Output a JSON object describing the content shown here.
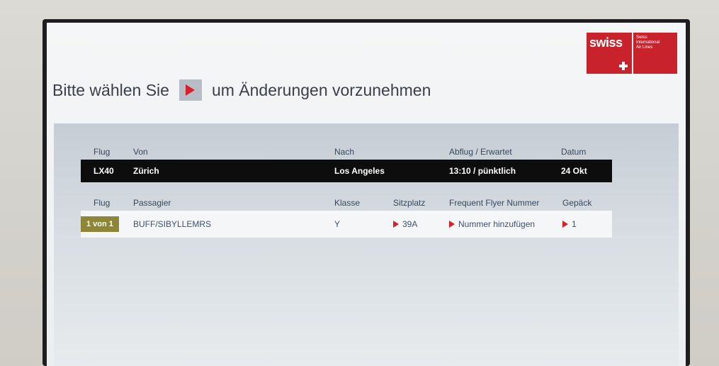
{
  "logo": {
    "word": "swiss",
    "text": "Swiss\nInternational\nAir Lines"
  },
  "heading": {
    "before": "Bitte wählen Sie",
    "after": "um Änderungen vorzunehmen",
    "arrow_icon": "red-play-arrow-icon"
  },
  "flight_header": {
    "flug": "Flug",
    "von": "Von",
    "nach": "Nach",
    "abflug": "Abflug / Erwartet",
    "datum": "Datum"
  },
  "flight": {
    "flug": "LX40",
    "von": "Zürich",
    "nach": "Los Angeles",
    "abflug": "13:10  / pünktlich",
    "datum": "24 Okt"
  },
  "pax_header": {
    "flug": "Flug",
    "passagier": "Passagier",
    "klasse": "Klasse",
    "sitzplatz": "Sitzplatz",
    "ffn": "Frequent Flyer Nummer",
    "gepaeck": "Gepäck"
  },
  "passenger": {
    "flug": "1 von 1",
    "passagier": "BUFF/SIBYLLEMRS",
    "klasse": "Y",
    "sitzplatz": "39A",
    "ffn": "Nummer hinzufügen",
    "gepaeck": "1"
  },
  "colors": {
    "accent_red": "#d6202b",
    "brand_red": "#c8232c",
    "badge_olive": "#8c8636"
  }
}
